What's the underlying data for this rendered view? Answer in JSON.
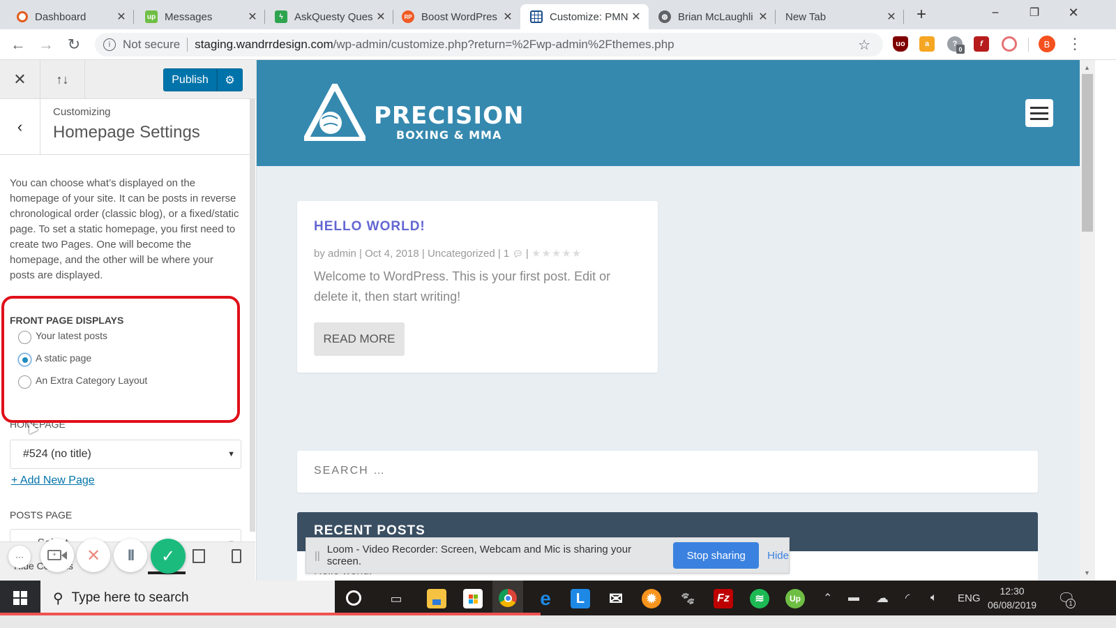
{
  "browser": {
    "tabs": [
      {
        "label": "Dashboard",
        "icon": "wp-circle-icon",
        "color": "#e25c1e",
        "active": false
      },
      {
        "label": "Messages",
        "icon": "upwork-icon",
        "color": "#6fbe44",
        "active": false
      },
      {
        "label": "AskQuesty Ques",
        "icon": "askquesty-icon",
        "color": "#2ea44f",
        "active": false
      },
      {
        "label": "Boost WordPres",
        "icon": "rp-icon",
        "color": "#f15a24",
        "active": false
      },
      {
        "label": "Customize: PMN",
        "icon": "grid-icon",
        "color": "#1a4d8c",
        "active": true
      },
      {
        "label": "Brian McLaughli",
        "icon": "globe-icon",
        "color": "#5f6368",
        "active": false
      },
      {
        "label": "New Tab",
        "icon": "",
        "color": "",
        "active": false
      }
    ],
    "new_tab_label": "+",
    "window": {
      "minimize": "−",
      "restore": "❐",
      "close": "✕"
    },
    "address": {
      "security_label": "Not secure",
      "domain": "staging.wandrrdesign.com",
      "path": "/wp-admin/customize.php?return=%2Fwp-admin%2Fthemes.php"
    },
    "extensions": [
      {
        "name": "ublock-icon",
        "label": "uo",
        "color": "#800000"
      },
      {
        "name": "shopping-bag-icon",
        "label": "a",
        "color": "#f5a623"
      },
      {
        "name": "help-badge-icon",
        "label": "?",
        "color": "#9aa0a6",
        "badge": "0"
      },
      {
        "name": "flash-icon",
        "label": "f",
        "color": "#b71c1c"
      },
      {
        "name": "swirl-icon",
        "label": "",
        "color": "#e57373"
      }
    ],
    "profile_initial": "B",
    "profile_color": "#f4511e"
  },
  "customizer": {
    "publish_label": "Publish",
    "customizing_label": "Customizing",
    "section_title": "Homepage Settings",
    "description": "You can choose what’s displayed on the homepage of your site. It can be posts in reverse chronological order (classic blog), or a fixed/static page. To set a static homepage, you first need to create two Pages. One will become the homepage, and the other will be where your posts are displayed.",
    "front_page_label": "FRONT PAGE DISPLAYS",
    "front_page_options": [
      {
        "label": "Your latest posts",
        "selected": false
      },
      {
        "label": "A static page",
        "selected": true
      },
      {
        "label": "An Extra Category Layout",
        "selected": false
      }
    ],
    "homepage_label": "HOMEPAGE",
    "homepage_value": "#524 (no title)",
    "add_new_page_label": "+ Add New Page",
    "posts_page_label": "POSTS PAGE",
    "posts_page_value": "— Select —",
    "hidden_controls_label": "Hide Controls",
    "accent_color": "#0073aa",
    "highlight_color": "#e0101a"
  },
  "loom_controls": {
    "more_label": "···",
    "cancel_label": "✕",
    "pause_label": "II",
    "done_label": "✓"
  },
  "preview": {
    "header_color": "#3589af",
    "logo_name": "PRECISION",
    "logo_sub": "BOXING & MMA",
    "post": {
      "title": "HELLO WORLD!",
      "meta_author": "by admin",
      "meta_date": "Oct 4, 2018",
      "meta_category": "Uncategorized",
      "meta_comments": "1",
      "rating_stars": 0,
      "rating_max": 5,
      "excerpt": "Welcome to WordPress. This is your first post. Edit or delete it, then start writing!",
      "read_more_label": "READ MORE"
    },
    "search_placeholder": "SEARCH …",
    "recent_posts_title": "RECENT POSTS",
    "recent_posts_items": [
      "Hello world!"
    ]
  },
  "loom_banner": {
    "message": "Loom - Video Recorder: Screen, Webcam and Mic is sharing your screen.",
    "stop_label": "Stop sharing",
    "hide_label": "Hide"
  },
  "taskbar": {
    "search_placeholder": "Type here to search",
    "apps": [
      {
        "name": "cortana-icon"
      },
      {
        "name": "task-view-icon"
      },
      {
        "name": "file-explorer-icon"
      },
      {
        "name": "store-icon"
      },
      {
        "name": "chrome-icon"
      },
      {
        "name": "edge-icon"
      },
      {
        "name": "lexicon-app-icon",
        "label": "L"
      },
      {
        "name": "mail-icon"
      },
      {
        "name": "settings-wheel-icon"
      },
      {
        "name": "gimp-icon"
      },
      {
        "name": "filezilla-icon",
        "label": "Fz"
      },
      {
        "name": "spotify-icon"
      },
      {
        "name": "upwork-icon",
        "label": "Up"
      }
    ],
    "language": "ENG",
    "time": "12:30",
    "date": "06/08/2019",
    "notification_count": "1"
  }
}
